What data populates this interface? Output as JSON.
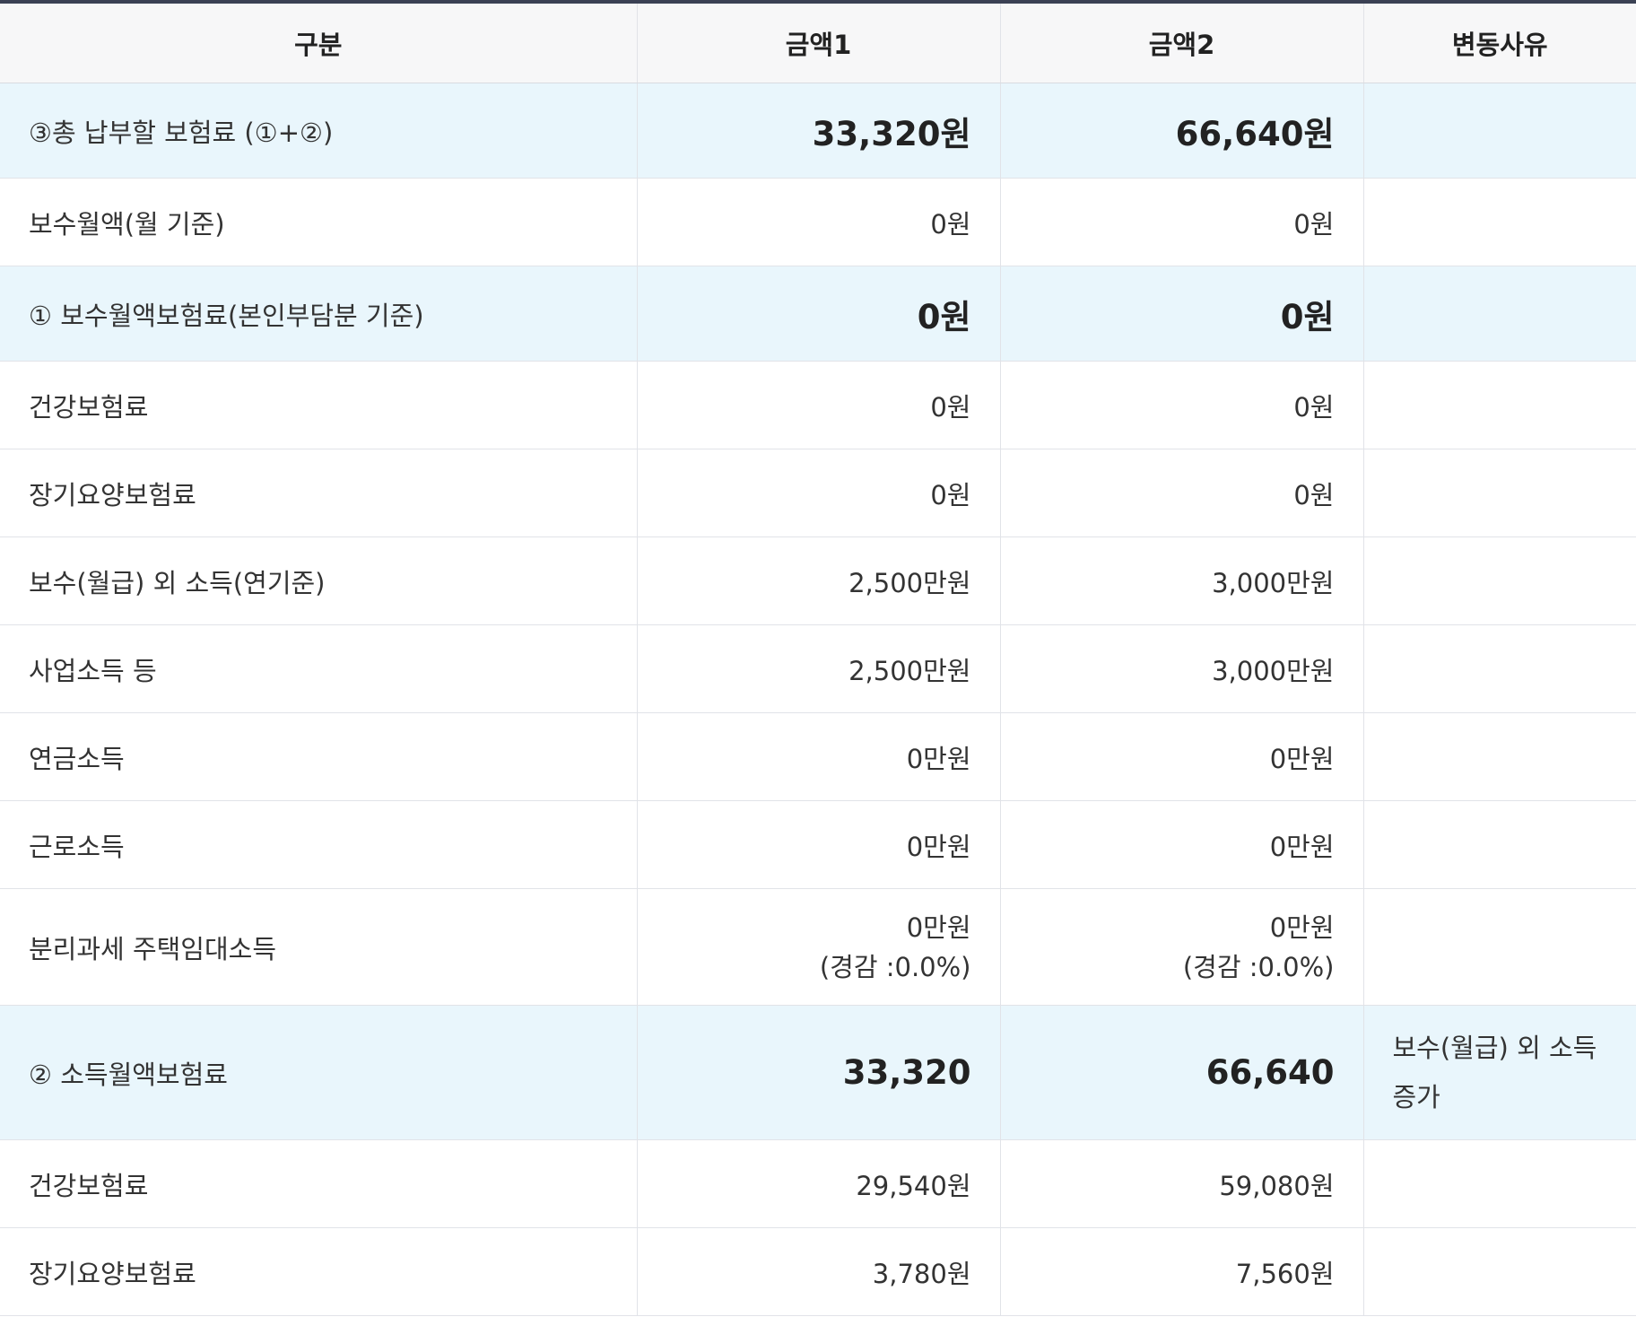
{
  "table": {
    "headers": [
      "구분",
      "금액1",
      "금액2",
      "변동사유"
    ],
    "rows": [
      {
        "label": "③총 납부할 보험료 (①+②)",
        "amount1": "33,320원",
        "amount2": "66,640원",
        "reason": ""
      },
      {
        "label": "보수월액(월 기준)",
        "amount1": "0원",
        "amount2": "0원",
        "reason": ""
      },
      {
        "label": "① 보수월액보험료(본인부담분 기준)",
        "amount1": "0원",
        "amount2": "0원",
        "reason": ""
      },
      {
        "label": "건강보험료",
        "amount1": "0원",
        "amount2": "0원",
        "reason": ""
      },
      {
        "label": "장기요양보험료",
        "amount1": "0원",
        "amount2": "0원",
        "reason": ""
      },
      {
        "label": "보수(월급) 외 소득(연기준)",
        "amount1": "2,500만원",
        "amount2": "3,000만원",
        "reason": ""
      },
      {
        "label": "사업소득 등",
        "amount1": "2,500만원",
        "amount2": "3,000만원",
        "reason": ""
      },
      {
        "label": "연금소득",
        "amount1": "0만원",
        "amount2": "0만원",
        "reason": ""
      },
      {
        "label": "근로소득",
        "amount1": "0만원",
        "amount2": "0만원",
        "reason": ""
      },
      {
        "label": "분리과세 주택임대소득",
        "amount1": "0만원",
        "amount1_note": "(경감 :0.0%)",
        "amount2": "0만원",
        "amount2_note": "(경감 :0.0%)",
        "reason": ""
      },
      {
        "label": "② 소득월액보험료",
        "amount1": "33,320",
        "amount2": "66,640",
        "reason_line1": "보수(월급) 외 소득",
        "reason_line2": "증가"
      },
      {
        "label": "건강보험료",
        "amount1": "29,540원",
        "amount2": "59,080원",
        "reason": ""
      },
      {
        "label": "장기요양보험료",
        "amount1": "3,780원",
        "amount2": "7,560원",
        "reason": ""
      }
    ]
  },
  "colors": {
    "highlight_row": "#e9f6fc",
    "header_bg": "#f7f7f8",
    "top_border": "#3b4154"
  }
}
